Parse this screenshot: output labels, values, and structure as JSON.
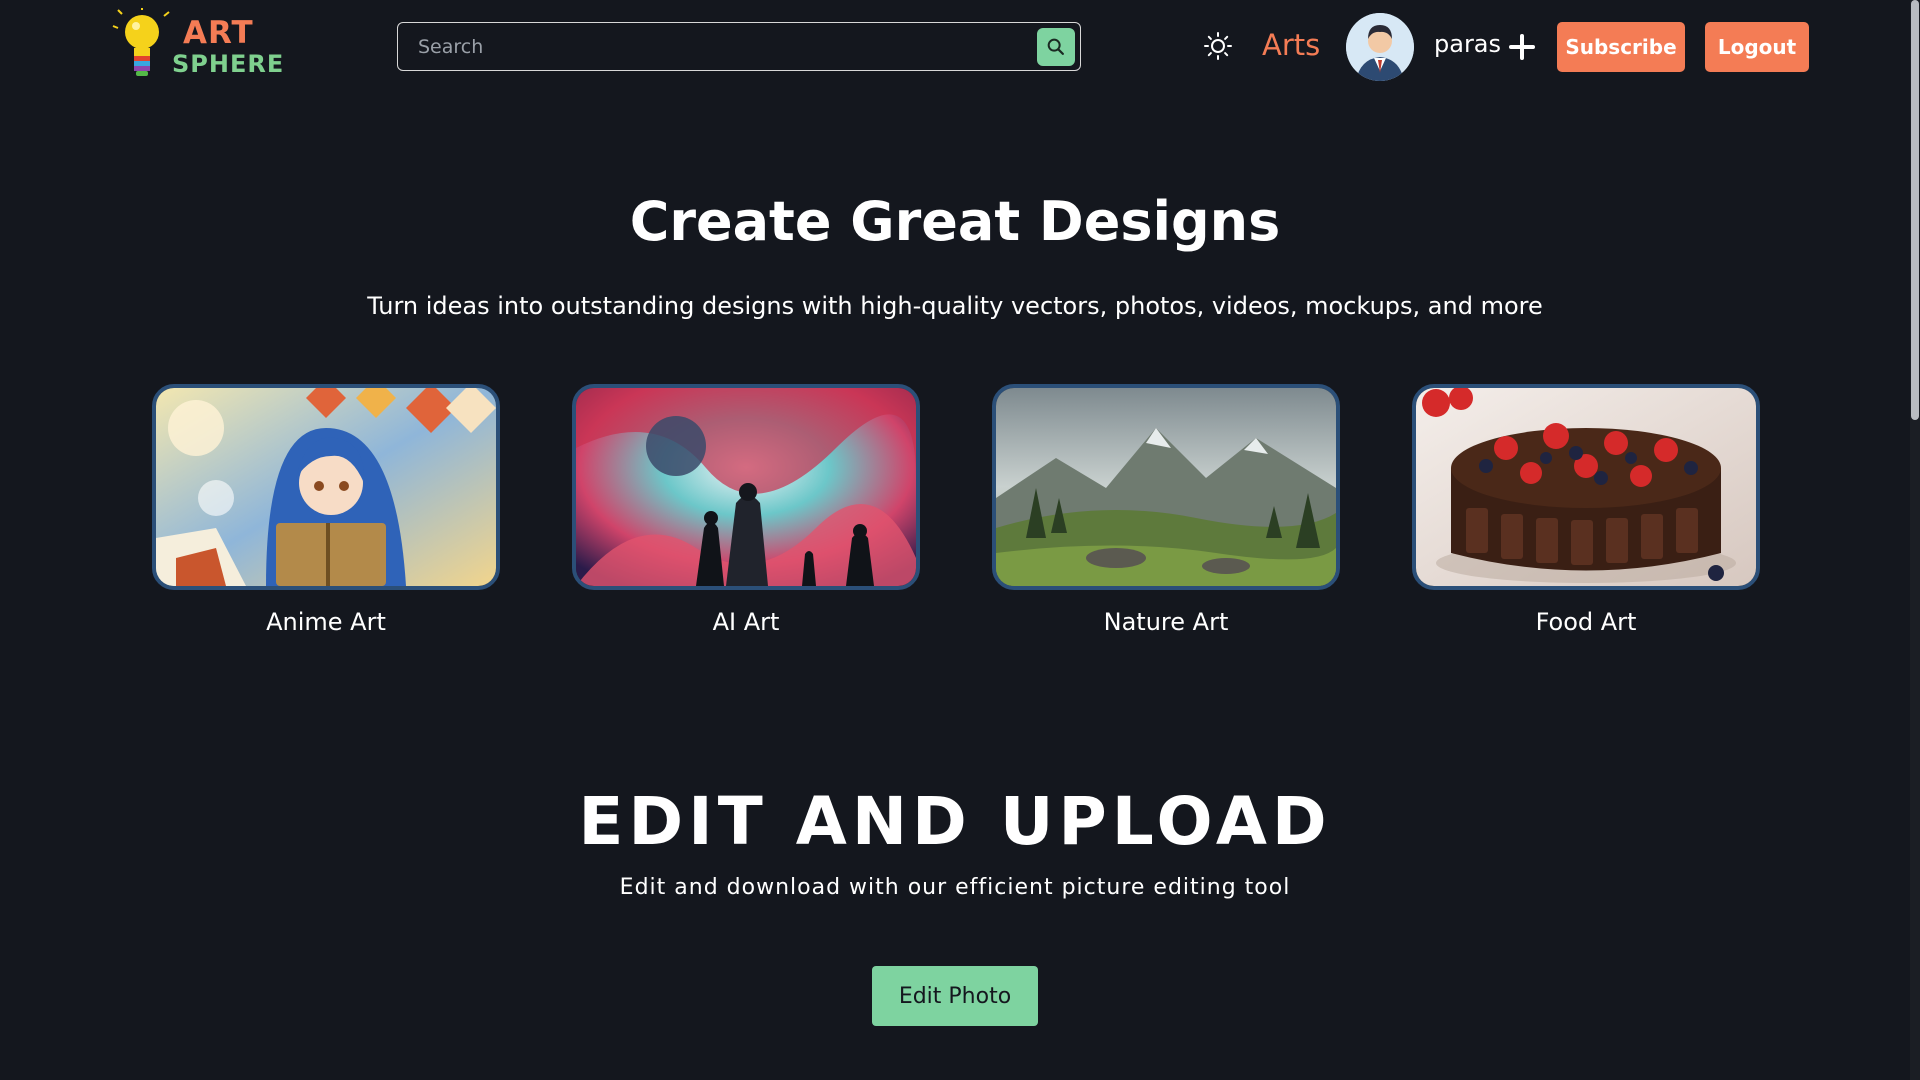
{
  "header": {
    "logo_line1": "ART",
    "logo_line2": "SPHERE",
    "search_placeholder": "Search",
    "nav_link": "Arts",
    "username": "paras",
    "subscribe_label": "Subscribe",
    "logout_label": "Logout"
  },
  "hero": {
    "title": "Create Great Designs",
    "subtitle": "Turn ideas into outstanding designs with high-quality vectors, photos, videos, mockups, and more"
  },
  "categories": [
    {
      "label": "Anime Art"
    },
    {
      "label": "AI Art"
    },
    {
      "label": "Nature Art"
    },
    {
      "label": "Food Art"
    }
  ],
  "edit_section": {
    "title": "EDIT AND UPLOAD",
    "subtitle": "Edit and download with our efficient picture editing tool",
    "button_label": "Edit Photo"
  },
  "colors": {
    "background": "#14171e",
    "accent_orange": "#f47c55",
    "accent_green": "#7ed3a0",
    "card_border": "#2b4f78"
  },
  "icons": [
    "bulb-logo-icon",
    "search-icon",
    "sun-icon",
    "user-avatar-icon",
    "plus-icon"
  ]
}
